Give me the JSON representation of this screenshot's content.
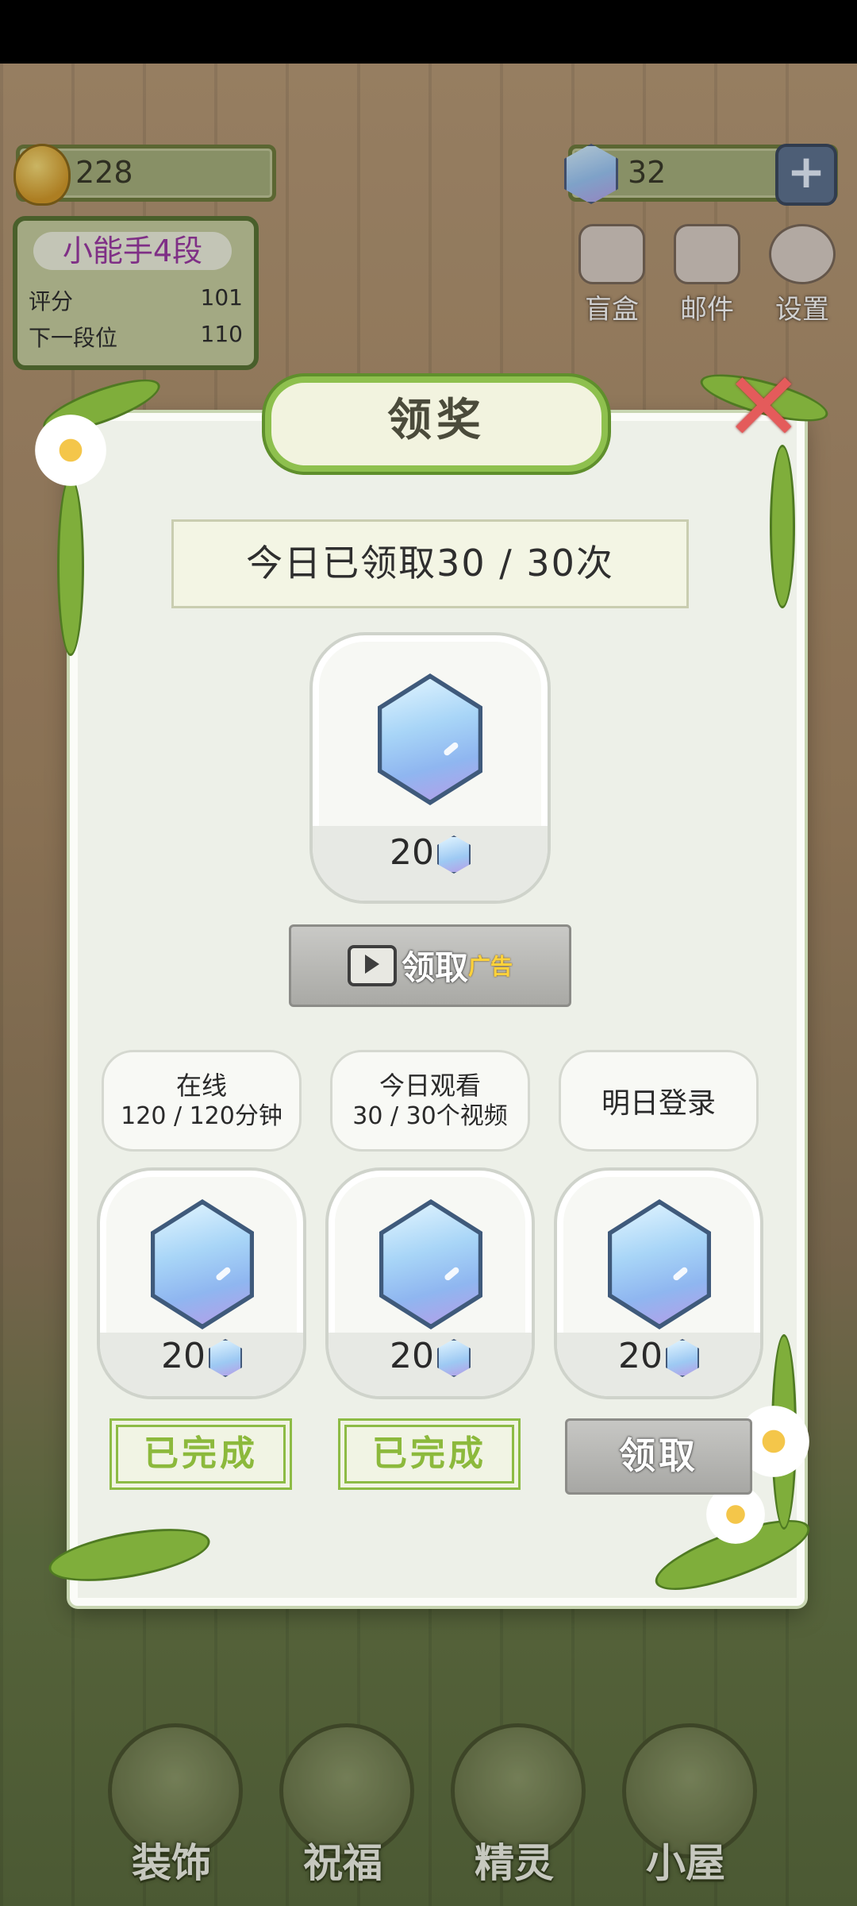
{
  "hud": {
    "coins": "228",
    "gems": "32",
    "plus_symbol": "+"
  },
  "rank": {
    "title": "小能手4段",
    "score_label": "评分",
    "score_value": "101",
    "next_label": "下一段位",
    "next_value": "110"
  },
  "top_buttons": [
    {
      "label": "盲盒",
      "icon": "gift-box-icon"
    },
    {
      "label": "邮件",
      "icon": "mail-icon"
    },
    {
      "label": "设置",
      "icon": "gear-icon"
    }
  ],
  "dialog": {
    "title": "领奖",
    "close_symbol": "✕",
    "daily_count": "今日已领取30 / 30次",
    "main_reward": {
      "amount": "20",
      "icon": "gem-icon"
    },
    "ad_button": {
      "label": "领取",
      "tag": "广告",
      "icon": "tv-play-icon"
    },
    "tasks": [
      {
        "line1": "在线",
        "line2": "120 / 120分钟",
        "reward": "20",
        "status": "已完成"
      },
      {
        "line1": "今日观看",
        "line2": "30 / 30个视频",
        "reward": "20",
        "status": "已完成"
      },
      {
        "line1": "明日登录",
        "line2": "",
        "reward": "20",
        "status": "领取"
      }
    ]
  },
  "bottom_nav": [
    {
      "label": "装饰",
      "icon": "plant-icon"
    },
    {
      "label": "祝福",
      "icon": "butterfly-icon"
    },
    {
      "label": "精灵",
      "icon": "fairy-icon"
    },
    {
      "label": "小屋",
      "icon": "house-icon"
    }
  ],
  "colors": {
    "accent_green": "#8cb93c",
    "close_red": "#e45b5b",
    "gem_blue": "#a8d5f7",
    "rank_purple": "#9b3aa4"
  }
}
